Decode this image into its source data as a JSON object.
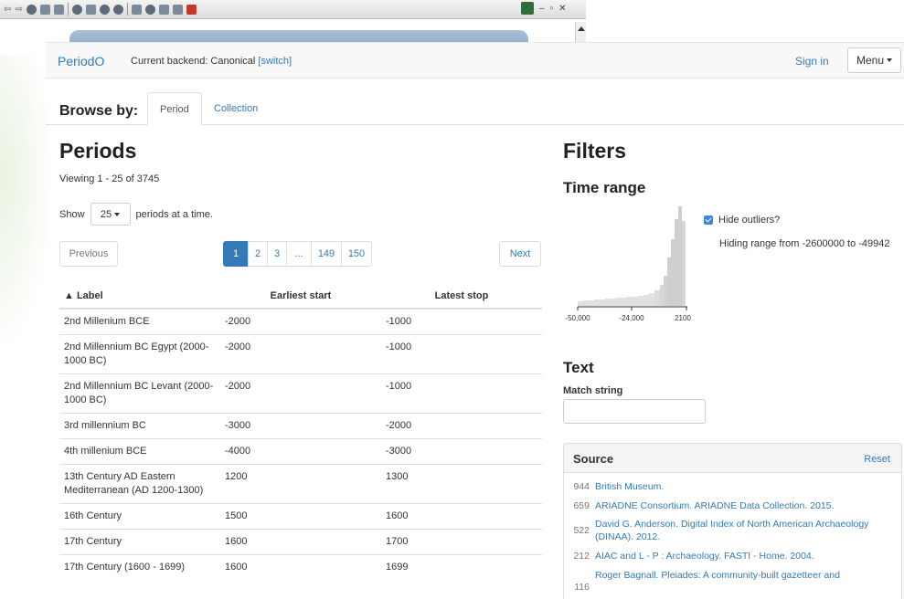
{
  "navbar": {
    "brand": "PeriodO",
    "backend_text": "Current backend: Canonical",
    "switch_link": "[switch]",
    "sign_in": "Sign in",
    "menu_label": "Menu"
  },
  "browse": {
    "label": "Browse by:",
    "tabs": [
      {
        "label": "Period",
        "active": true
      },
      {
        "label": "Collection",
        "active": false
      }
    ]
  },
  "periods": {
    "heading": "Periods",
    "viewing": "Viewing 1 - 25 of 3745",
    "show_prefix": "Show",
    "page_size": "25",
    "show_suffix": "periods at a time.",
    "previous": "Previous",
    "next": "Next",
    "pages": [
      "1",
      "2",
      "3",
      "...",
      "149",
      "150"
    ],
    "current_page": "1",
    "columns": [
      "▲ Label",
      "Earliest start",
      "Latest stop"
    ],
    "rows": [
      {
        "label": "2nd Millenium BCE",
        "start": "-2000",
        "stop": "-1000"
      },
      {
        "label": "2nd Millennium BC Egypt (2000-1000 BC)",
        "start": "-2000",
        "stop": "-1000"
      },
      {
        "label": "2nd Millennium BC Levant (2000-1000 BC)",
        "start": "-2000",
        "stop": "-1000"
      },
      {
        "label": "3rd millennium BC",
        "start": "-3000",
        "stop": "-2000"
      },
      {
        "label": "4th millenium BCE",
        "start": "-4000",
        "stop": "-3000"
      },
      {
        "label": "13th Century AD Eastern Mediterranean (AD 1200-1300)",
        "start": "1200",
        "stop": "1300"
      },
      {
        "label": "16th Century",
        "start": "1500",
        "stop": "1600"
      },
      {
        "label": "17th Century",
        "start": "1600",
        "stop": "1700"
      },
      {
        "label": "17th Century (1600 - 1699)",
        "start": "1600",
        "stop": "1699"
      }
    ]
  },
  "filters": {
    "heading": "Filters",
    "time_range": {
      "heading": "Time range",
      "hide_outliers_label": "Hide outliers?",
      "hide_outliers_checked": true,
      "hiding_range": "Hiding range from -2600000 to -49942",
      "axis_ticks": [
        "-50,000",
        "-24,000",
        "2100"
      ]
    },
    "text": {
      "heading": "Text",
      "match_label": "Match string",
      "match_value": ""
    },
    "source": {
      "heading": "Source",
      "reset": "Reset",
      "items": [
        {
          "count": "944",
          "title": "British Museum."
        },
        {
          "count": "659",
          "title": "ARIADNE Consortium. ARIADNE Data Collection. 2015."
        },
        {
          "count": "522",
          "title": "David G. Anderson. Digital Index of North American Archaeology (DINAA). 2012."
        },
        {
          "count": "212",
          "title": "AIAC and L - P : Archaeology. FASTI - Home. 2004."
        },
        {
          "count": "116",
          "title": "Roger Bagnall. Pleiades: A community-built gazetteer and"
        }
      ]
    }
  },
  "colors": {
    "link": "#337ab7",
    "active_page": "#337ab7",
    "navbar_bg": "#f8f8f8",
    "histogram": "#cfcfcf"
  }
}
